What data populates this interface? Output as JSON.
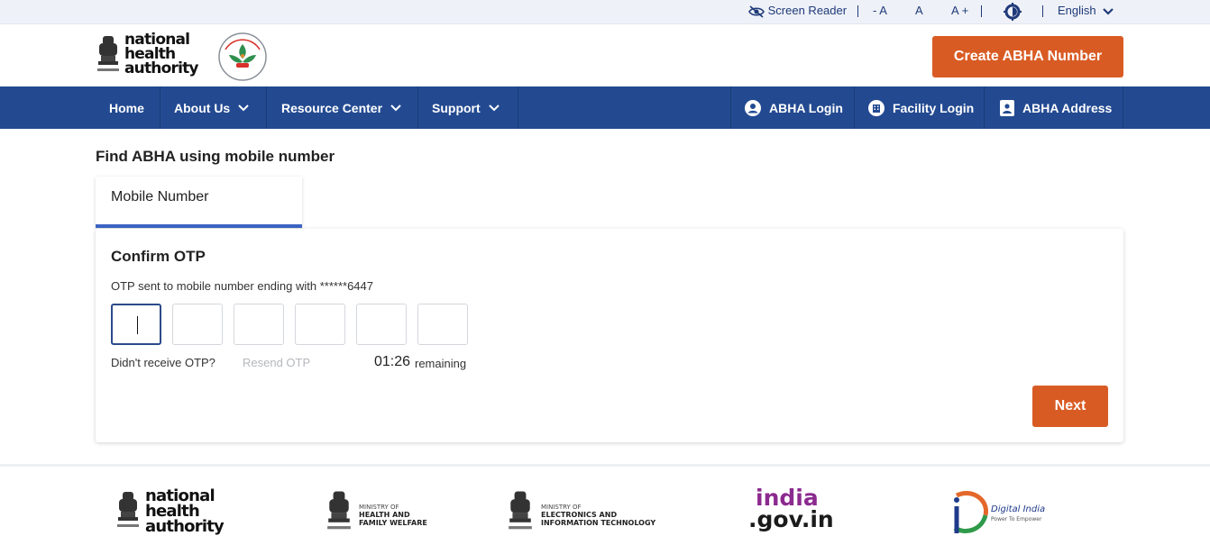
{
  "utility": {
    "screen_reader": "Screen Reader",
    "font_decrease": "- A",
    "font_normal": "A",
    "font_increase": "A +",
    "language": "English"
  },
  "brand": {
    "logo_line1": "national",
    "logo_line2": "health",
    "logo_line3": "authority",
    "create_button": "Create ABHA Number"
  },
  "nav": {
    "home": "Home",
    "about": "About Us",
    "resource": "Resource Center",
    "support": "Support",
    "abha_login": "ABHA Login",
    "facility_login": "Facility Login",
    "abha_address": "ABHA Address"
  },
  "main": {
    "page_title": "Find ABHA using mobile number",
    "tab_label": "Mobile Number",
    "card_title": "Confirm OTP",
    "otp_message": "OTP sent to mobile number ending with ******6447",
    "otp_digits": [
      "",
      "",
      "",
      "",
      "",
      ""
    ],
    "didnt_receive": "Didn't receive OTP?",
    "resend": "Resend OTP",
    "timer": "01:26",
    "timer_suffix": "remaining",
    "next_button": "Next"
  },
  "footer": {
    "nha_line1": "national",
    "nha_line2": "health",
    "nha_line3": "authority",
    "mohfw_line1": "MINISTRY OF",
    "mohfw_line2": "HEALTH AND",
    "mohfw_line3": "FAMILY WELFARE",
    "meity_line1": "MINISTRY OF",
    "meity_line2": "ELECTRONICS AND",
    "meity_line3": "INFORMATION TECHNOLOGY",
    "india_gov_line1": "india",
    "india_gov_line2": ".gov.in",
    "digital_india_line1": "Digital India",
    "digital_india_line2": "Power To Empower"
  },
  "colors": {
    "nav_blue": "#234a91",
    "accent_orange": "#d95b24",
    "tab_underline": "#3c64c4"
  }
}
